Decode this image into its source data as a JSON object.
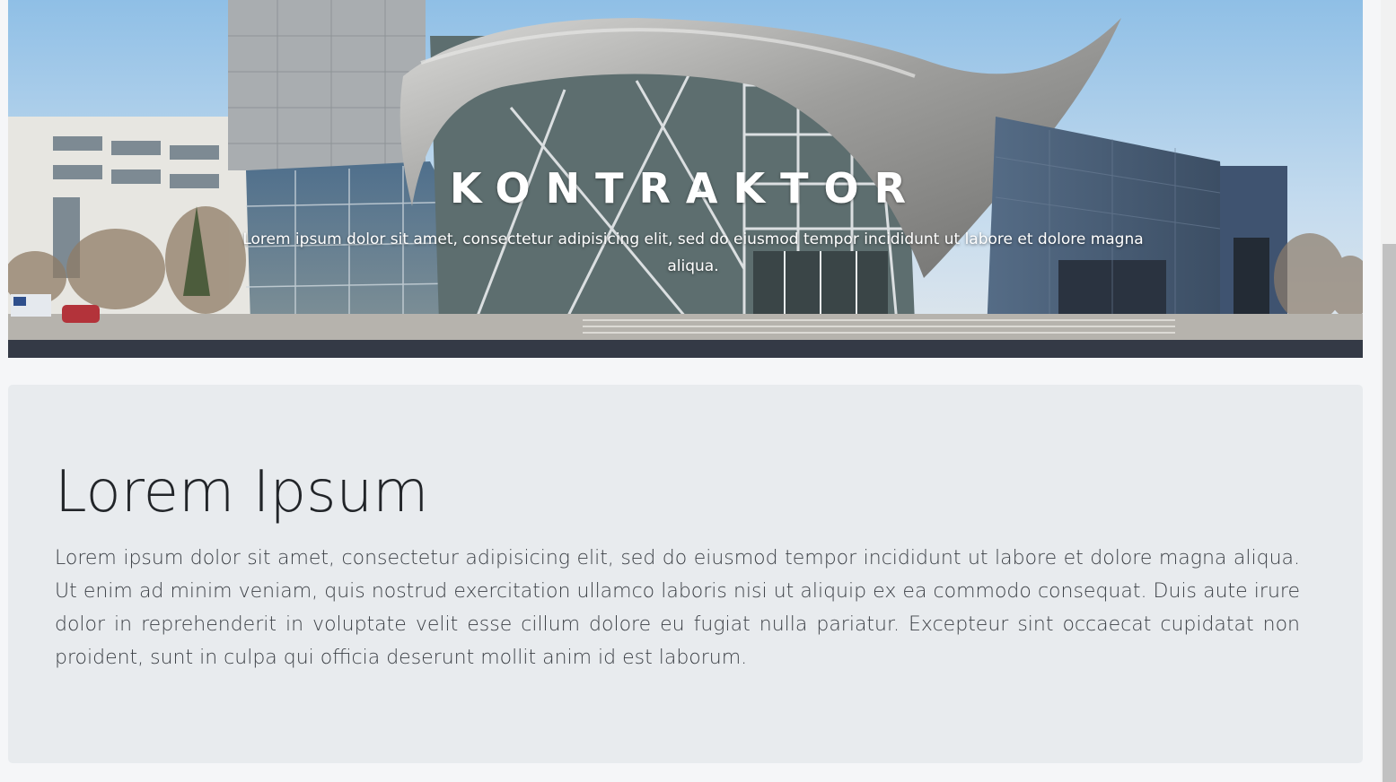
{
  "hero": {
    "title": "KONTRAKTOR",
    "subtitle": "Lorem ipsum dolor sit amet, consectetur adipisicing elit, sed do eiusmod tempor incididunt ut labore et dolore magna aliqua."
  },
  "jumbotron": {
    "heading": "Lorem Ipsum",
    "text": "Lorem ipsum dolor sit amet, consectetur adipisicing elit, sed do eiusmod tempor incididunt ut labore et dolore magna aliqua. Ut enim ad minim veniam, quis nostrud exercitation ullamco laboris nisi ut aliquip ex ea commodo consequat. Duis aute irure dolor in reprehenderit in voluptate velit esse cillum dolore eu fugiat nulla pariatur. Excepteur sint occaecat cupidatat non proident, sunt in culpa qui officia deserunt mollit anim id est laborum."
  },
  "colors": {
    "page_background": "#f5f6f8",
    "hero_bar": "#343a46",
    "jumbotron_background": "#e8ebee",
    "heading_text": "#222529",
    "body_text": "#3c4046"
  }
}
